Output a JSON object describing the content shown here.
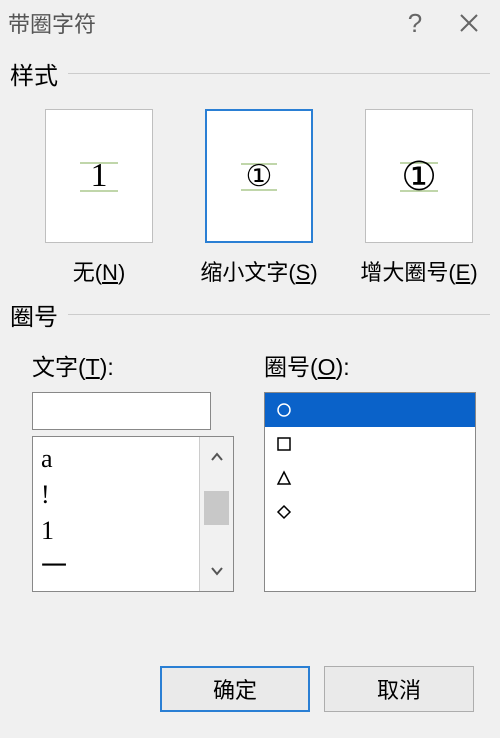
{
  "title": "带圈字符",
  "sections": {
    "style": "样式",
    "enclosure": "圈号"
  },
  "styles": {
    "none": {
      "label_pre": "无(",
      "key": "N",
      "label_post": ")",
      "glyph": "1"
    },
    "shrink": {
      "label_pre": "缩小文字(",
      "key": "S",
      "label_post": ")",
      "glyph": "①"
    },
    "enlarge": {
      "label_pre": "增大圈号(",
      "key": "E",
      "label_post": ")",
      "glyph": "①"
    }
  },
  "text_col": {
    "label_pre": "文字(",
    "key": "T",
    "label_post": "):",
    "input_value": "",
    "list": [
      "a",
      "!",
      "1",
      "一"
    ]
  },
  "shape_col": {
    "label_pre": "圈号(",
    "key": "O",
    "label_post": "):",
    "shapes": [
      "circle",
      "square",
      "triangle",
      "diamond"
    ],
    "selected_index": 0
  },
  "buttons": {
    "ok": "确定",
    "cancel": "取消"
  }
}
